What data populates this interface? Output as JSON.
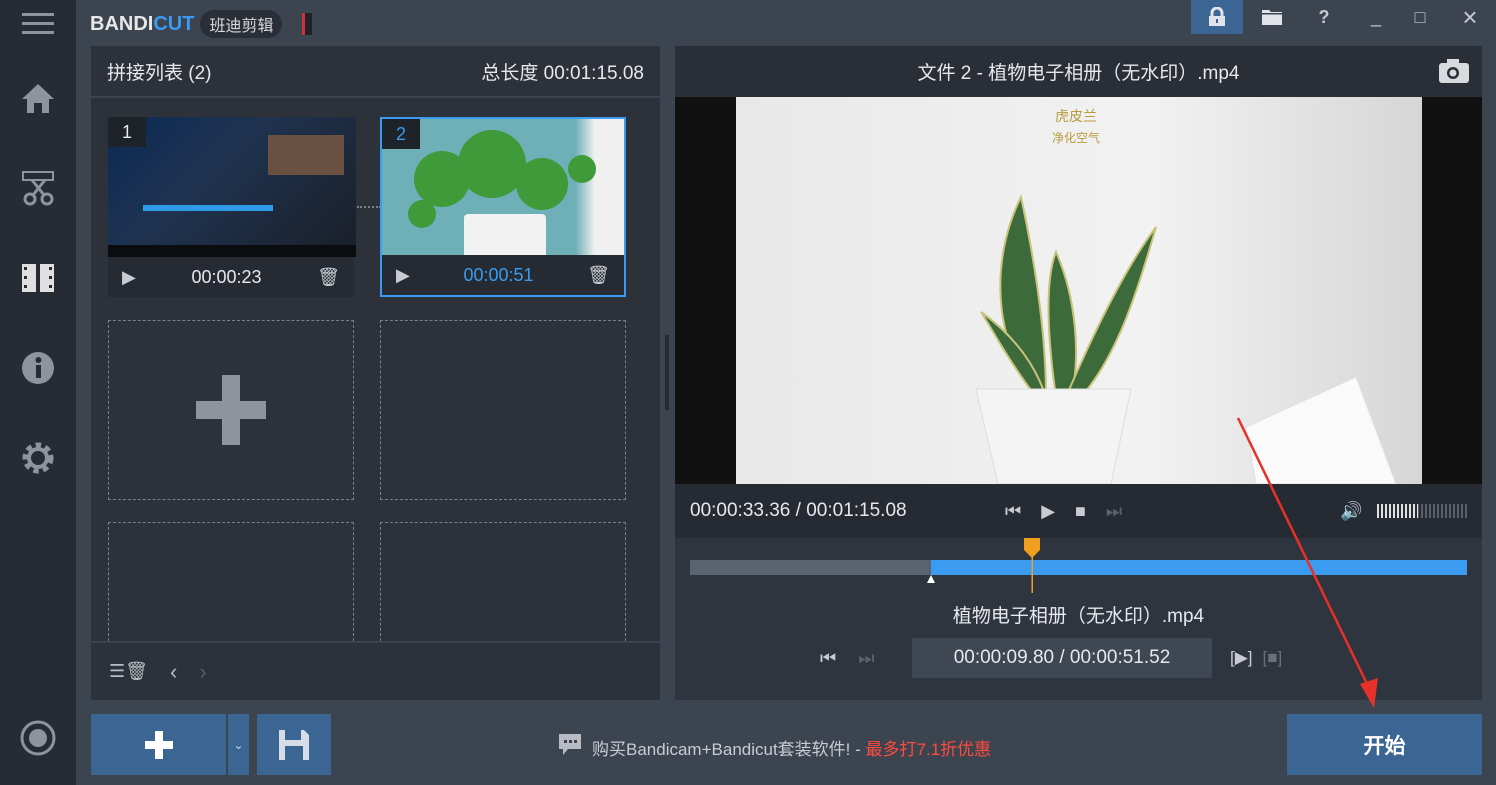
{
  "app": {
    "logo_main": "BANDI",
    "logo_accent": "CUT",
    "logo_badge": "班迪剪辑"
  },
  "window_controls": {
    "lock": "lock-icon",
    "folder": "folder-icon",
    "help": "?",
    "minimize": "_",
    "maximize": "□",
    "close": "×"
  },
  "sidebar": {
    "items": [
      "menu",
      "home",
      "cut",
      "join",
      "info",
      "settings",
      "record"
    ]
  },
  "join_list": {
    "title": "拼接列表 (2)",
    "total_label": "总长度 00:01:15.08",
    "clips": [
      {
        "index": "1",
        "duration": "00:00:23"
      },
      {
        "index": "2",
        "duration": "00:00:51"
      }
    ]
  },
  "preview": {
    "title": "文件 2 - 植物电子相册（无水印）.mp4",
    "watermark_1": "虎皮兰",
    "watermark_2": "净化空气",
    "time": "00:00:33.36 / 00:01:15.08",
    "volume_level": 0.45,
    "timeline_split_fraction": 0.31,
    "playhead_fraction": 0.44,
    "clip_name": "植物电子相册（无水印）.mp4",
    "clip_time": "00:00:09.80 / 00:00:51.52"
  },
  "footer": {
    "promo_text": "购买Bandicam+Bandicut套装软件!",
    "promo_sep": " - ",
    "promo_highlight": "最多打7.1折优惠",
    "start_label": "开始"
  },
  "colors": {
    "accent": "#3a9bf0",
    "start": "#3b6593",
    "promo": "#ff4b3e",
    "playhead": "#f0a01e"
  }
}
